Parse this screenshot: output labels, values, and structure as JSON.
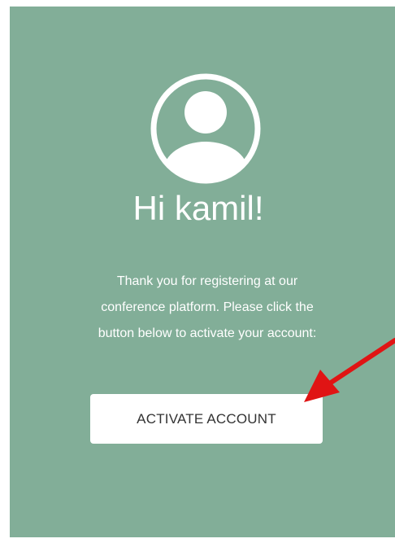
{
  "greeting": "Hi kamil!",
  "message": {
    "line1": "Thank you for registering at our",
    "line2": "conference platform. Please click the",
    "line3": "button below to activate your account:"
  },
  "button": {
    "label": "ACTIVATE ACCOUNT"
  },
  "icons": {
    "avatar": "user-avatar-icon",
    "annotation": "red-arrow"
  },
  "colors": {
    "card_background": "#82ae98",
    "text": "#ffffff",
    "button_background": "#ffffff",
    "button_text": "#333333",
    "arrow": "#e01414"
  }
}
